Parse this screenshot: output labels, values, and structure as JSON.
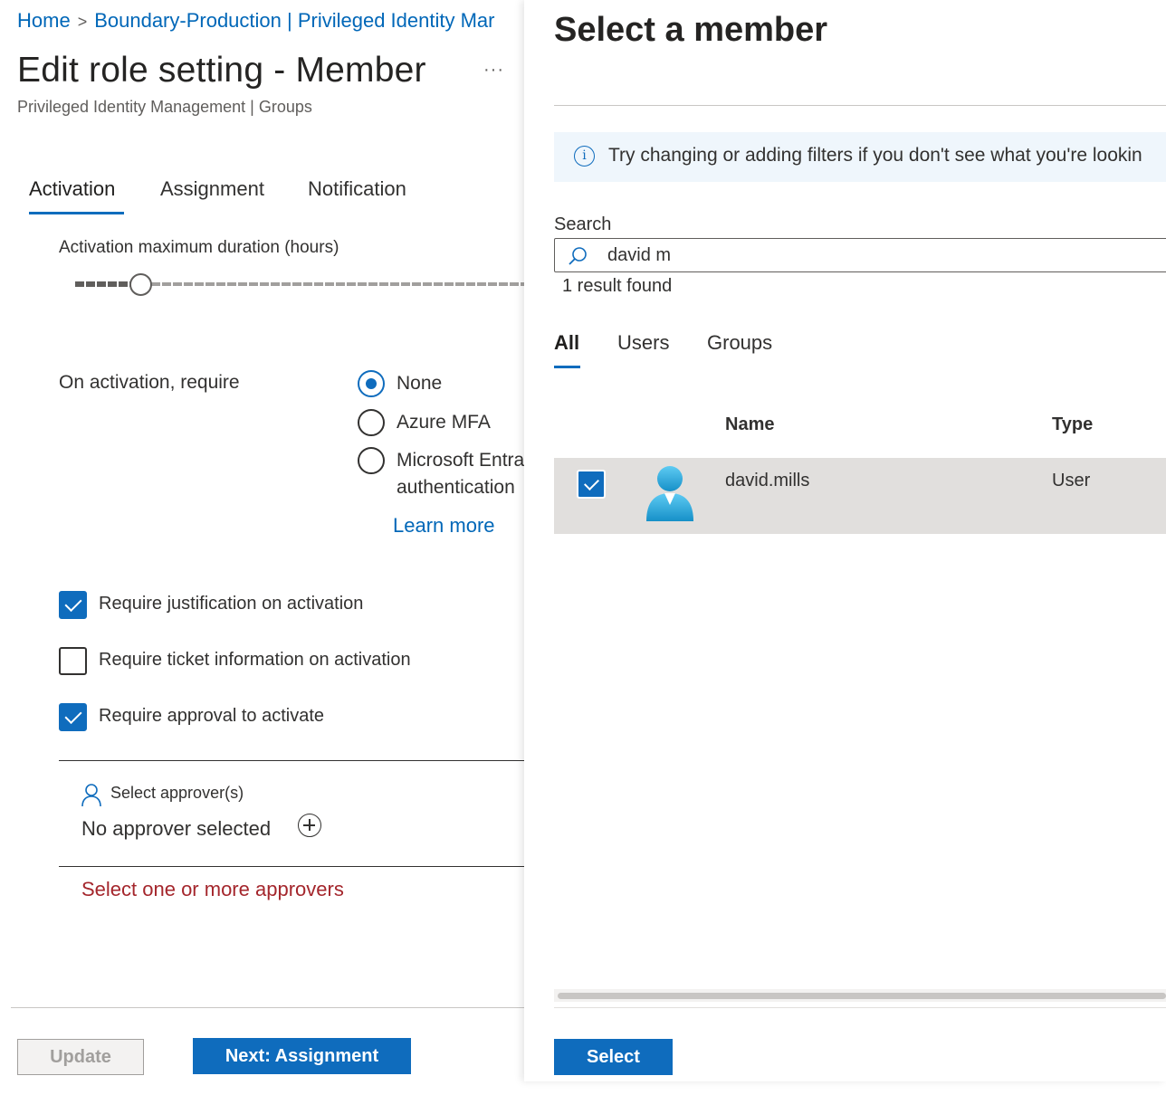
{
  "breadcrumb": {
    "home": "Home",
    "separator": ">",
    "current": "Boundary-Production | Privileged Identity Mar"
  },
  "page": {
    "title": "Edit role setting - Member",
    "more_menu": "···",
    "subtitle": "Privileged Identity Management | Groups"
  },
  "tabs": [
    {
      "label": "Activation",
      "active": true
    },
    {
      "label": "Assignment",
      "active": false
    },
    {
      "label": "Notification",
      "active": false
    }
  ],
  "activation": {
    "duration_label": "Activation maximum duration (hours)",
    "duration_slider_fraction": 0.12,
    "require_label": "On activation, require",
    "options": [
      {
        "label": "None",
        "selected": true
      },
      {
        "label": "Azure MFA",
        "selected": false
      },
      {
        "label": "Microsoft Entra",
        "label_line2": "authentication",
        "selected": false
      }
    ],
    "learn_more": "Learn more",
    "checkboxes": [
      {
        "label": "Require justification on activation",
        "checked": true
      },
      {
        "label": "Require ticket information on activation",
        "checked": false
      },
      {
        "label": "Require approval to activate",
        "checked": true
      }
    ],
    "approver": {
      "heading": "Select approver(s)",
      "icon": "person-icon",
      "value": "No approver selected",
      "add_icon": "add-circle-icon",
      "error": "Select one or more approvers"
    }
  },
  "footer": {
    "update": "Update",
    "next": "Next: Assignment"
  },
  "panel": {
    "title": "Select a member",
    "info": "Try changing or adding filters if you don't see what you're lookin",
    "info_icon": "info-icon",
    "search_label": "Search",
    "search_value": "david m",
    "result_count": "1 result found",
    "tabs": [
      {
        "label": "All",
        "active": true
      },
      {
        "label": "Users",
        "active": false
      },
      {
        "label": "Groups",
        "active": false
      }
    ],
    "columns": {
      "name": "Name",
      "type": "Type"
    },
    "rows": [
      {
        "name": "david.mills",
        "type": "User",
        "selected": true,
        "avatar": "user-avatar-icon"
      }
    ],
    "select_button": "Select"
  },
  "colors": {
    "accent": "#0f6cbd",
    "link": "#0067b8",
    "error": "#a4262c",
    "selected_row": "#e1dfdd",
    "info_bar": "#eff6fc"
  }
}
